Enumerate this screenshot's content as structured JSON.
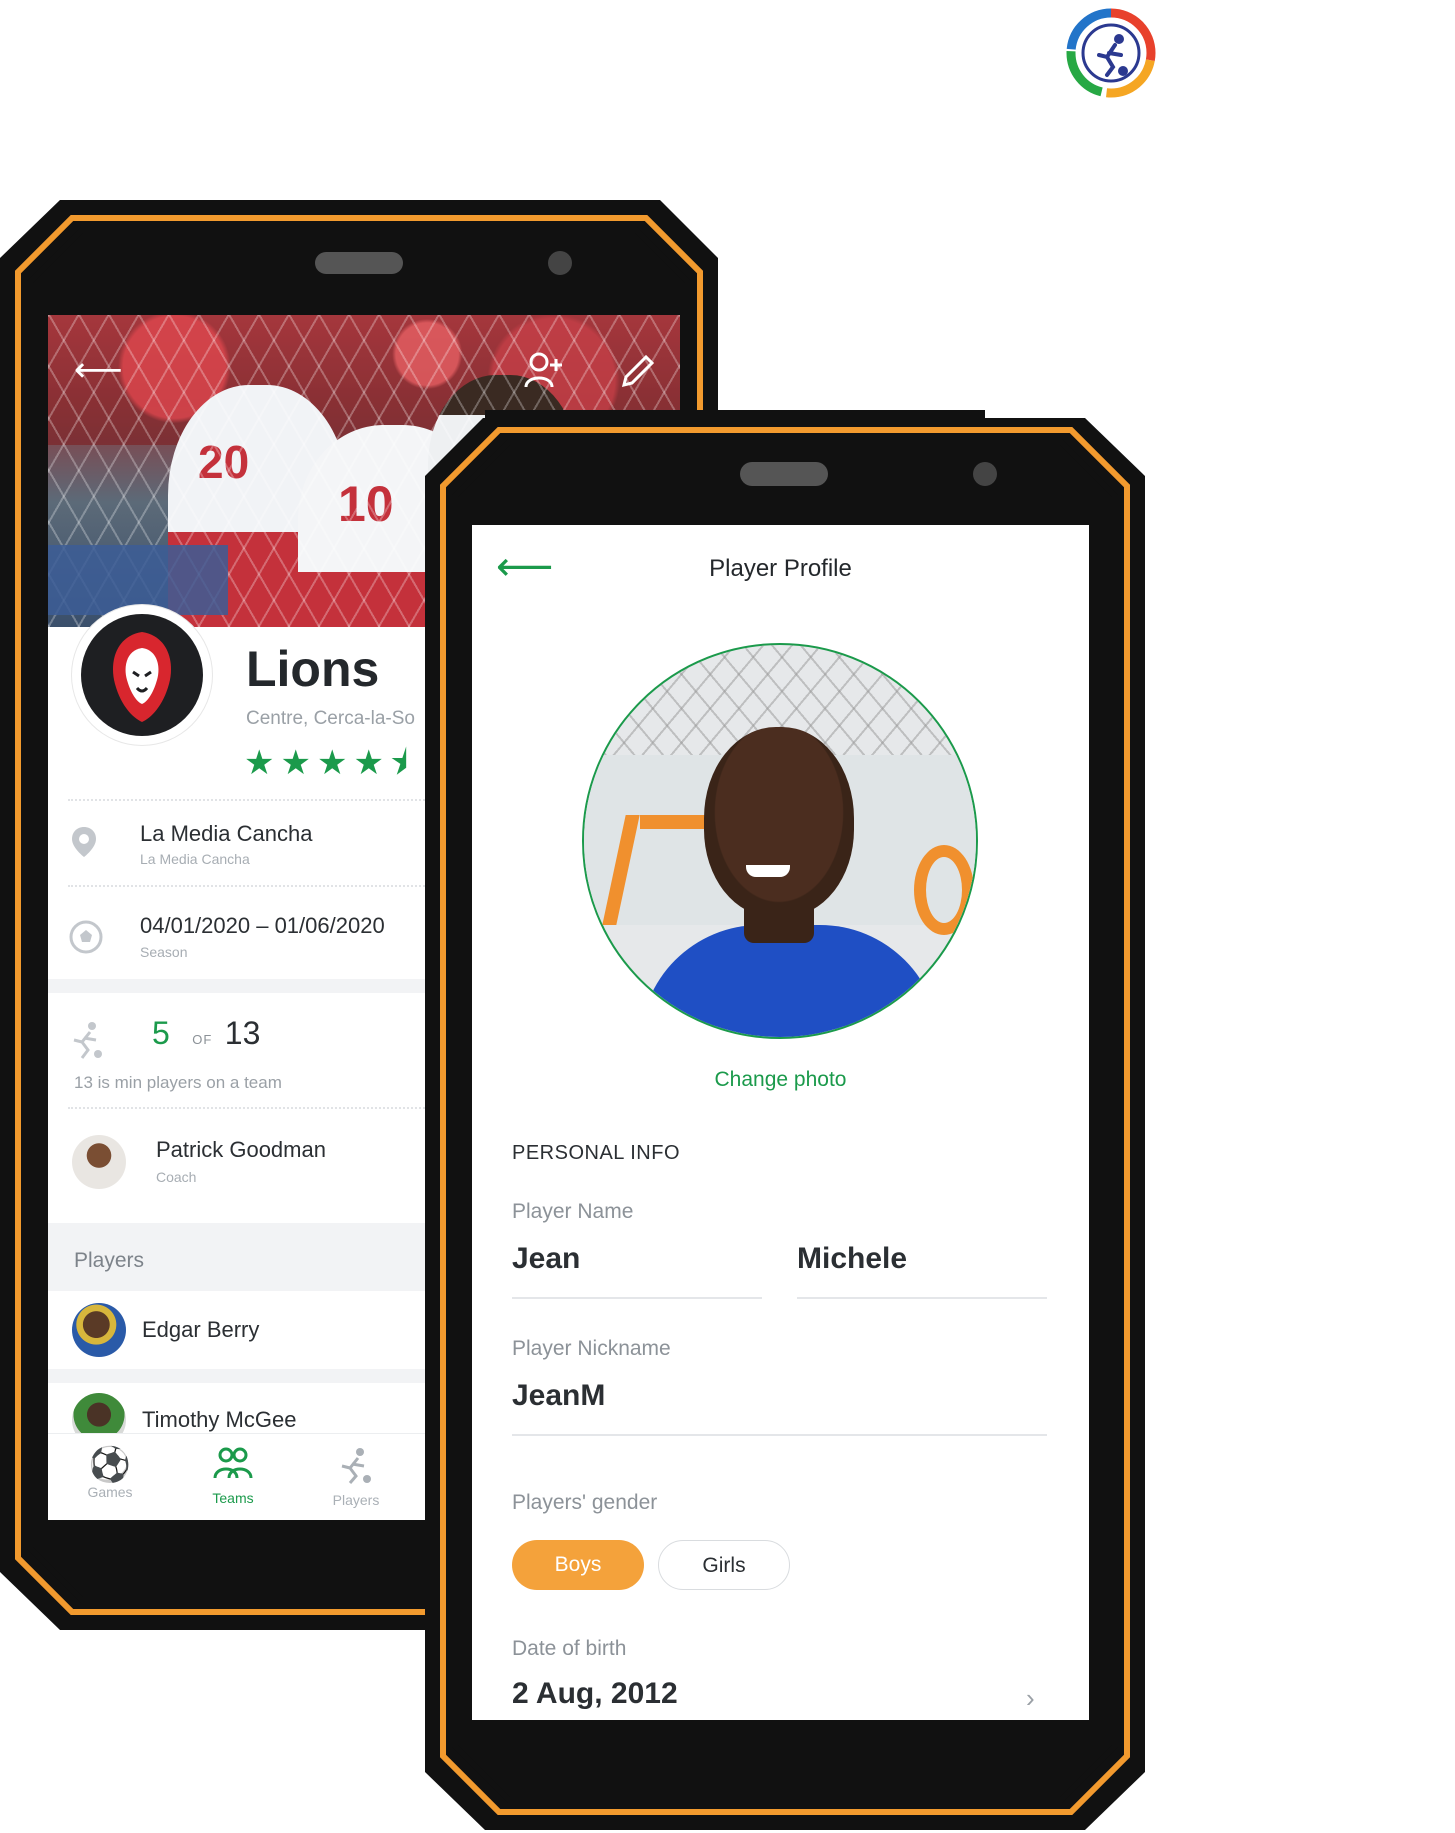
{
  "brand": {
    "logo_icon": "soccer-player-ring-logo"
  },
  "colors": {
    "accent_green": "#1b9a4b",
    "accent_orange": "#f4a23b",
    "frame_black": "#111111",
    "frame_orange": "#f29a2e"
  },
  "team_screen": {
    "icons": {
      "back": "arrow-left-icon",
      "add_member": "add-user-icon",
      "edit": "pencil-icon"
    },
    "team_name": "Lions",
    "team_location": "Centre, Cerca-la-So",
    "rating": 4.5,
    "stars_text": "★★★★⯨",
    "venue": {
      "name": "La Media Cancha",
      "sub": "La Media Cancha"
    },
    "season": {
      "dates": "04/01/2020 – 01/06/2020",
      "label": "Season"
    },
    "roster": {
      "count": "5",
      "of_label": "OF",
      "total": "13",
      "note": "13 is min players on a team"
    },
    "coach": {
      "name": "Patrick Goodman",
      "role": "Coach"
    },
    "players_header": "Players",
    "players": [
      {
        "name": "Edgar Berry"
      },
      {
        "name": "Timothy McGee"
      }
    ],
    "tabs": [
      {
        "label": "Games",
        "icon": "soccer-ball-icon",
        "active": false
      },
      {
        "label": "Teams",
        "icon": "group-icon",
        "active": true
      },
      {
        "label": "Players",
        "icon": "running-player-icon",
        "active": false
      }
    ]
  },
  "profile_screen": {
    "title": "Player Profile",
    "change_photo": "Change photo",
    "section": "PERSONAL INFO",
    "player_name_label": "Player Name",
    "first_name": "Jean",
    "last_name": "Michele",
    "nickname_label": "Player Nickname",
    "nickname": "JeanM",
    "gender_label": "Players' gender",
    "gender_options": [
      "Boys",
      "Girls"
    ],
    "gender_selected": "Boys",
    "dob_label": "Date of birth",
    "dob": "2 Aug, 2012"
  }
}
